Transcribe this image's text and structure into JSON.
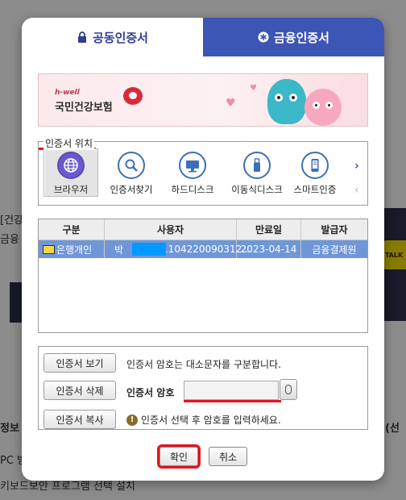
{
  "tabs": [
    {
      "label": "공동인증서",
      "icon": "lock-icon",
      "active": true
    },
    {
      "label": "금융인증서",
      "icon": "asterisk-icon",
      "active": false
    }
  ],
  "banner": {
    "sub": "h-well",
    "title": "국민건강보험"
  },
  "background": {
    "text_a": "[건강",
    "text_b": "금융",
    "text_c": "정보",
    "text_d": "PC 방",
    "text_e": "키보드보안 프로그램 선택 설치",
    "text_f": "(선",
    "talk": "TALK"
  },
  "cert_location": {
    "label": "인증서 위치",
    "items": [
      {
        "label": "브라우저",
        "icon": "globe-icon",
        "selected": true
      },
      {
        "label": "인증서찾기",
        "icon": "search-icon",
        "selected": false
      },
      {
        "label": "하드디스크",
        "icon": "monitor-icon",
        "selected": false
      },
      {
        "label": "이동식디스크",
        "icon": "usb-icon",
        "selected": false
      },
      {
        "label": "스마트인증",
        "icon": "smartphone-icon",
        "selected": false
      }
    ],
    "next_icon": "chevron-right-icon",
    "prev_icon": "chevron-left-icon"
  },
  "cert_table": {
    "headers": [
      "구분",
      "사용자",
      "만료일",
      "발급자"
    ],
    "rows": [
      {
        "type": "은행개인",
        "user": "박",
        "user_suffix": "1104220090312...",
        "expiry": "2023-04-14",
        "issuer": "금융결제원"
      }
    ]
  },
  "actions": {
    "view": "인증서 보기",
    "delete": "인증서 삭제",
    "copy": "인증서 복사",
    "case_note": "인증서 암호는 대소문자를 구분합니다.",
    "pw_label": "인증서 암호",
    "pw_value": "",
    "warn": "인증서 선택 후 암호를 입력하세요."
  },
  "footer": {
    "ok": "확인",
    "cancel": "취소"
  },
  "colors": {
    "tab_active_text": "#2f3f8f",
    "tab_inactive_bg": "#3d55b4",
    "selected_row": "#6f97d8",
    "highlight_red": "#e3151d"
  }
}
